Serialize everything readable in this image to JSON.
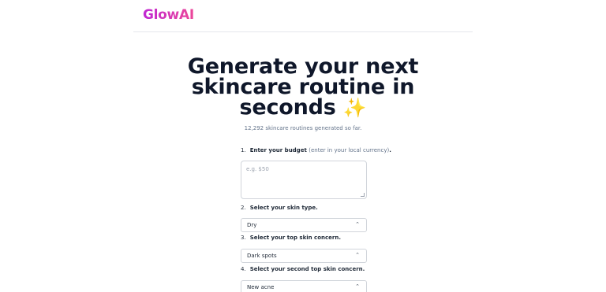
{
  "header": {
    "logo": "GlowAI"
  },
  "hero": {
    "line1": "Generate your next",
    "line2": "skincare routine in",
    "line3": "seconds",
    "sparkles": "✨"
  },
  "counter": "12,292 skincare routines generated so far.",
  "form": {
    "step1": {
      "num": "1.",
      "label": "Enter your budget",
      "hint": "(enter in your local currency)",
      "suffix": "."
    },
    "budget_placeholder": "e.g. $50",
    "step2": {
      "num": "2.",
      "label": "Select your skin type."
    },
    "skin_type": "Dry",
    "step3": {
      "num": "3.",
      "label": "Select your top skin concern."
    },
    "top_concern": "Dark spots",
    "step4": {
      "num": "4.",
      "label": "Select your second top skin concern."
    },
    "second_concern": "New acne",
    "chevron": "⌃"
  }
}
